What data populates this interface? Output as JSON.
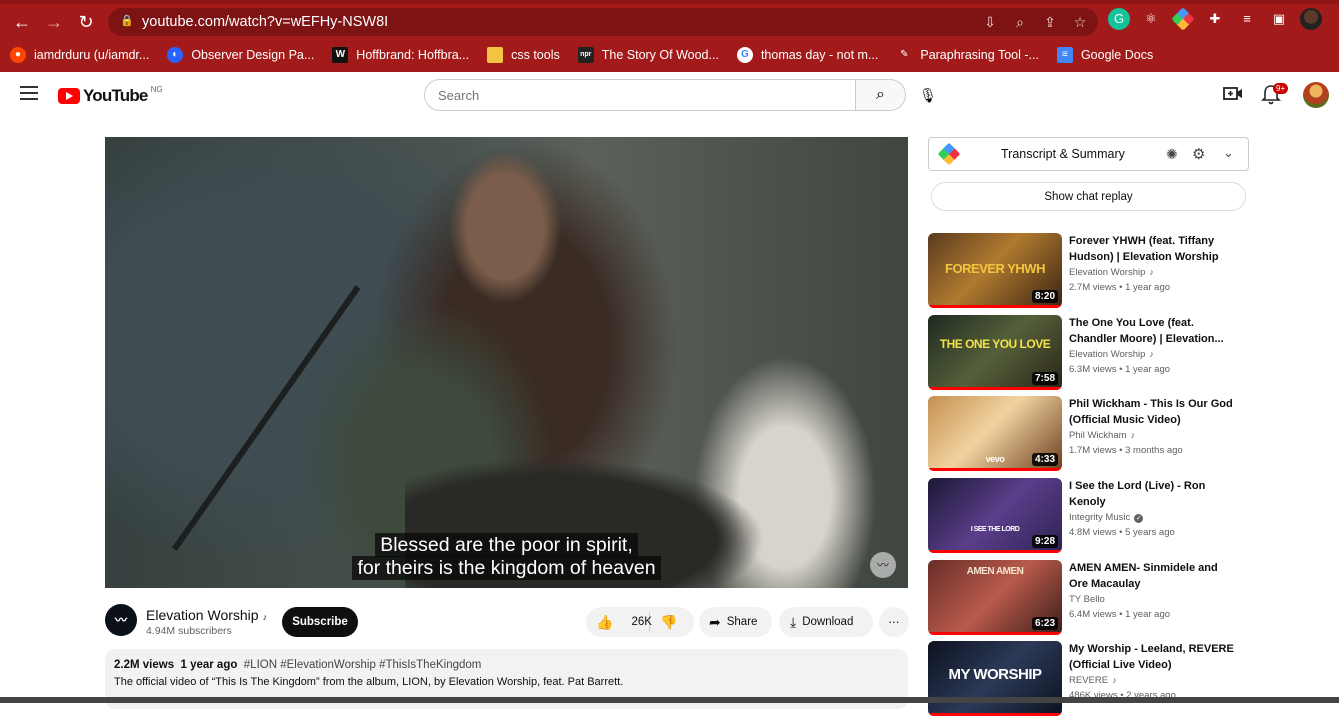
{
  "browser": {
    "url": "youtube.com/watch?v=wEFHy-NSW8I",
    "bookmarks": [
      {
        "label": "iamdrduru (u/iamdr...",
        "icon": "reddit-icon",
        "color": "#ff4500"
      },
      {
        "label": "Observer Design Pa...",
        "icon": "observer-icon",
        "color": "#2962ff"
      },
      {
        "label": "Hoffbrand: Hoffbra...",
        "icon": "w-icon",
        "color": "#111111"
      },
      {
        "label": "css tools",
        "icon": "folder-icon",
        "color": "#f4c542"
      },
      {
        "label": "The Story Of Wood...",
        "icon": "npr-icon",
        "color": "#222222"
      },
      {
        "label": "thomas day - not m...",
        "icon": "google-icon",
        "color": "#ffffff"
      },
      {
        "label": "Paraphrasing Tool -...",
        "icon": "quill-icon",
        "color": "#cc3333"
      },
      {
        "label": "Google Docs",
        "icon": "docs-icon",
        "color": "#4285f4"
      }
    ]
  },
  "header": {
    "logo_text": "YouTube",
    "region": "NG",
    "search_placeholder": "Search",
    "notif_count": "9+"
  },
  "player": {
    "subtitle_line1": "Blessed are the poor in spirit,",
    "subtitle_line2": "for theirs is the kingdom of heaven"
  },
  "channel": {
    "name": "Elevation Worship",
    "subscribers": "4.94M subscribers",
    "subscribe_label": "Subscribe",
    "likes": "26K",
    "share_label": "Share",
    "download_label": "Download"
  },
  "description": {
    "views": "2.2M views",
    "age": "1 year ago",
    "tags": "#LION #ElevationWorship #ThisIsTheKingdom",
    "text": "The official video of “This Is The Kingdom” from the album, LION, by Elevation Worship, feat. Pat Barrett."
  },
  "sidebar": {
    "transcript_label": "Transcript & Summary",
    "chat_replay_label": "Show chat replay",
    "recommendations": [
      {
        "title": "Forever YHWH (feat. Tiffany Hudson) | Elevation Worship",
        "channel": "Elevation Worship",
        "music": true,
        "verified": false,
        "views": "2.7M views",
        "age": "1 year ago",
        "duration": "8:20",
        "thumb_text": "FOREVER YHWH",
        "bg": "linear-gradient(135deg,#5a3b1e,#b07a2e 45%,#3a2413)",
        "text_color": "#f2c440"
      },
      {
        "title": "The One You Love (feat. Chandler Moore) | Elevation...",
        "channel": "Elevation Worship",
        "music": true,
        "verified": false,
        "views": "6.3M views",
        "age": "1 year ago",
        "duration": "7:58",
        "thumb_text": "THE ONE YOU LOVE",
        "bg": "linear-gradient(135deg,#1f2a20,#55603a 50%,#2a2418)",
        "text_color": "#f3e24a"
      },
      {
        "title": "Phil Wickham - This Is Our God (Official Music Video)",
        "channel": "Phil Wickham",
        "music": true,
        "verified": false,
        "views": "1.7M views",
        "age": "3 months ago",
        "duration": "4:33",
        "thumb_text": "vevo",
        "bg": "linear-gradient(135deg,#c49050,#f1d3a0 45%,#6b3e1f)",
        "text_color": "#ffffff"
      },
      {
        "title": "I See the Lord (Live) - Ron Kenoly",
        "channel": "Integrity Music",
        "music": false,
        "verified": true,
        "views": "4.8M views",
        "age": "5 years ago",
        "duration": "9:28",
        "thumb_text": "I SEE THE LORD",
        "bg": "linear-gradient(135deg,#1c1835,#5a3e8a 50%,#2d2353)",
        "text_color": "#ffffff"
      },
      {
        "title": "AMEN AMEN- Sinmidele and Ore Macaulay",
        "channel": "TY Bello",
        "music": false,
        "verified": false,
        "views": "6.4M views",
        "age": "1 year ago",
        "duration": "6:23",
        "thumb_text": "AMEN AMEN",
        "bg": "linear-gradient(135deg,#6a2e2a,#b85a4a 50%,#3a1c1a)",
        "text_color": "#f4e4d0"
      },
      {
        "title": "My Worship - Leeland, REVERE (Official Live Video)",
        "channel": "REVERE",
        "music": true,
        "verified": false,
        "views": "486K views",
        "age": "2 years ago",
        "duration": "",
        "thumb_text": "MY WORSHIP",
        "bg": "linear-gradient(135deg,#0d1220,#2c3a58 50%,#0d1220)",
        "text_color": "#ffffff"
      }
    ]
  }
}
